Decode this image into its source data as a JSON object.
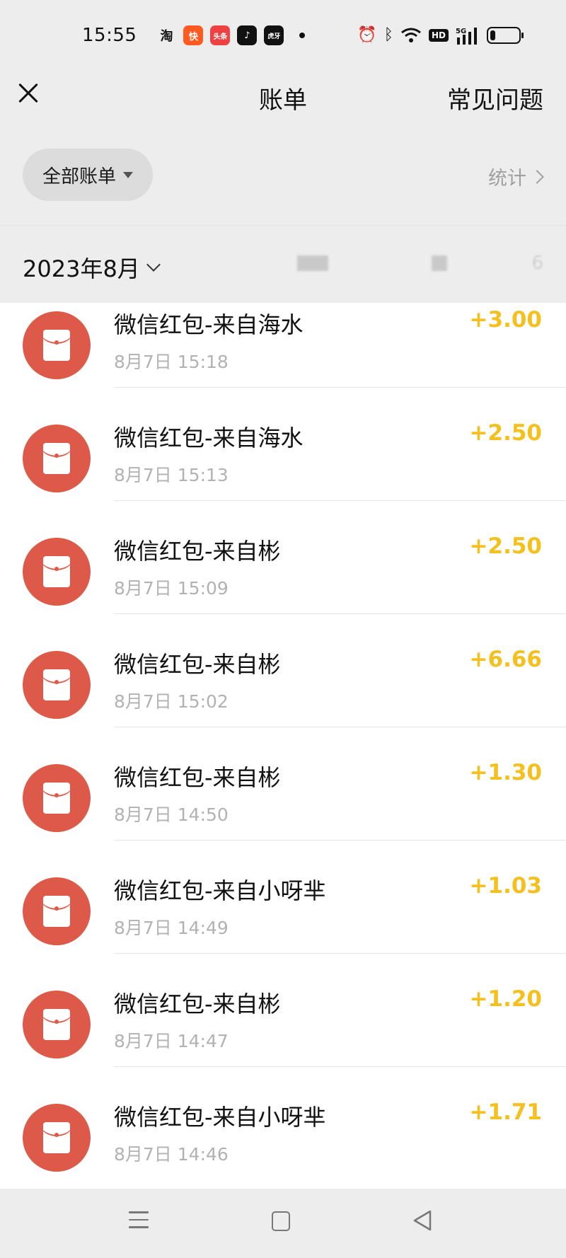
{
  "status_bar": {
    "time": "15:55",
    "apps": [
      {
        "name": "taobao",
        "glyph": "淘"
      },
      {
        "name": "kuaishou",
        "glyph": "快"
      },
      {
        "name": "toutiao",
        "glyph": "头条"
      },
      {
        "name": "douyin",
        "glyph": "♪"
      },
      {
        "name": "huya",
        "glyph": "虎牙"
      }
    ],
    "network": "5G",
    "hd": "HD",
    "battery_level": 0.18
  },
  "header": {
    "title": "账单",
    "faq_label": "常见问题"
  },
  "filter": {
    "label": "全部账单",
    "stats_label": "统计"
  },
  "month": {
    "label": "2023年8月",
    "summary_partial": "6"
  },
  "transactions": [
    {
      "title": "微信红包-来自海水",
      "time": "8月7日 15:18",
      "amount": "+3.00"
    },
    {
      "title": "微信红包-来自海水",
      "time": "8月7日 15:13",
      "amount": "+2.50"
    },
    {
      "title": "微信红包-来自彬",
      "time": "8月7日 15:09",
      "amount": "+2.50"
    },
    {
      "title": "微信红包-来自彬",
      "time": "8月7日 15:02",
      "amount": "+6.66"
    },
    {
      "title": "微信红包-来自彬",
      "time": "8月7日 14:50",
      "amount": "+1.30"
    },
    {
      "title": "微信红包-来自小呀芈",
      "time": "8月7日 14:49",
      "amount": "+1.03"
    },
    {
      "title": "微信红包-来自彬",
      "time": "8月7日 14:47",
      "amount": "+1.20"
    },
    {
      "title": "微信红包-来自小呀芈",
      "time": "8月7日 14:46",
      "amount": "+1.71"
    }
  ],
  "colors": {
    "background": "#ededed",
    "list_background": "#ffffff",
    "avatar": "#dd5a4b",
    "amount": "#f4c01f",
    "muted": "#b2b2b2"
  },
  "icons": {
    "close": "close-icon",
    "dropdown": "triangle-down-icon",
    "stats_chevron": "chevron-right-icon",
    "month_chevron": "chevron-down-icon",
    "red_packet": "red-packet-icon",
    "menu": "menu-icon",
    "home": "home-icon",
    "back": "back-icon"
  }
}
